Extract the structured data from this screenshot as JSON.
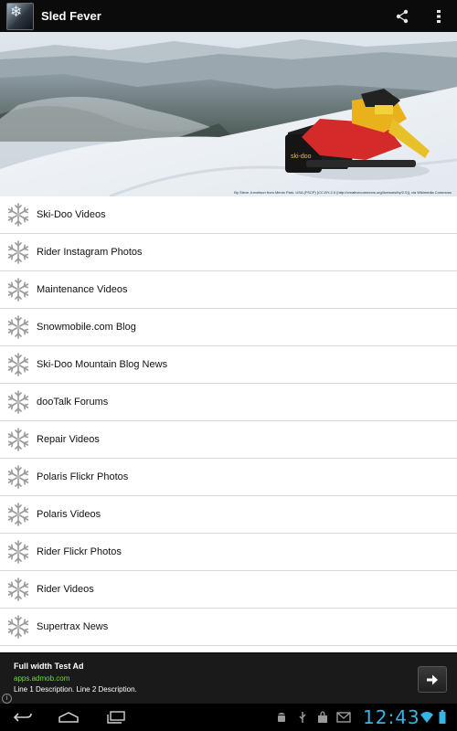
{
  "action_bar": {
    "title": "Sled Fever",
    "app_icon": "snowflake-app-icon",
    "actions": [
      "share-icon",
      "overflow-menu-icon"
    ]
  },
  "header_image": {
    "description_icon": "snowmobile-photo",
    "credit": "By Steve Jurvetson from Menlo Park, USA (FSCP) [CC-BY-2.0 (http://creativecommons.org/licenses/by/2.0)], via Wikimedia Commons"
  },
  "list": {
    "item_icon": "snowflake-icon",
    "items": [
      {
        "label": "Ski-Doo Videos"
      },
      {
        "label": "Rider Instagram Photos"
      },
      {
        "label": "Maintenance Videos"
      },
      {
        "label": "Snowmobile.com Blog"
      },
      {
        "label": "Ski-Doo Mountain Blog News"
      },
      {
        "label": "dooTalk Forums"
      },
      {
        "label": "Repair Videos"
      },
      {
        "label": "Polaris Flickr Photos"
      },
      {
        "label": "Polaris Videos"
      },
      {
        "label": "Rider Flickr Photos"
      },
      {
        "label": "Rider Videos"
      },
      {
        "label": "Supertrax News"
      }
    ]
  },
  "ad": {
    "title": "Full width Test Ad",
    "url": "apps.admob.com",
    "description": "Line 1 Description. Line 2 Description.",
    "button_icon": "arrow-right-icon",
    "info_icon": "info-icon",
    "url_color": "#7bd645"
  },
  "system_bar": {
    "time": "12:43",
    "nav_icons": [
      "back-icon",
      "home-icon",
      "recent-apps-icon"
    ],
    "status_icons": [
      "android-debug-icon",
      "usb-icon",
      "shopping-bag-icon",
      "gmail-icon",
      "wifi-icon",
      "battery-icon"
    ],
    "accent_color": "#33b5e5"
  }
}
